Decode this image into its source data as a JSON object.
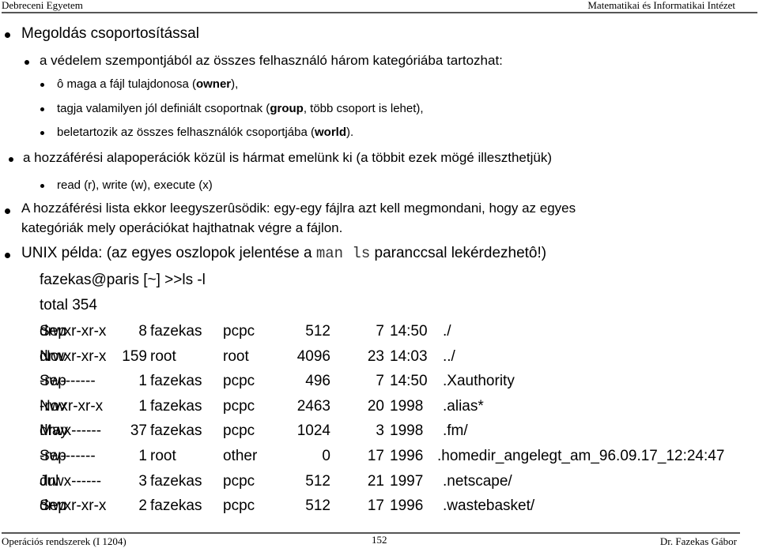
{
  "header": {
    "left": "Debreceni Egyetem",
    "right": "Matematikai és Informatikai Intézet"
  },
  "footer": {
    "left": "Operációs rendszerek (I 1204)",
    "page": "152",
    "right": "Dr. Fazekas Gábor"
  },
  "content": {
    "b1_title": "Megoldás csoportosítással",
    "b2_categories": "a védelem szempontjából az összes felhasználó három kategóriába tartozhat:",
    "b3_owner_pre": "ô maga a fájl tulajdonosa (",
    "b3_owner_bold": "owner",
    "b3_owner_post": "),",
    "b3_group_pre": "tagja valamilyen jól definiált csoportnak (",
    "b3_group_bold": "group",
    "b3_group_post": ", több csoport is lehet),",
    "b3_world_pre": "beletartozik az összes felhasználók csoportjába (",
    "b3_world_bold": "world",
    "b3_world_post": ").",
    "b2_ops": "a hozzáférési alapoperációk közül is hármat emelünk ki (a többit ezek mögé illeszthetjük)",
    "b3_rwx": "read (r), write (w), execute (x)",
    "b1_list_line1": "A hozzáférési lista ekkor leegyszerûsödik: egy-egy fájlra  azt kell megmondani, hogy az egyes",
    "b1_list_line2": "kategóriák mely operációkat hajthatnak végre a fájlon.",
    "b1_unix_pre": "UNIX példa: (az egyes oszlopok jelentése a ",
    "b1_unix_code": "man ls",
    "b1_unix_post": " paranccsal lekérdezhetô!)",
    "prompt": "fazekas@paris [~] >>ls -l",
    "total": "total 354"
  },
  "ls_rows": [
    {
      "perm": "drwxr-xr-x",
      "links": "8",
      "owner": "fazekas",
      "group": "pcpc",
      "size": "512",
      "month": "Sep",
      "day": "7",
      "time": "14:50",
      "name": "./"
    },
    {
      "perm": "drwxr-xr-x",
      "links": "159",
      "owner": "root",
      "group": "root",
      "size": "4096",
      "month": "Nov",
      "day": "23",
      "time": "14:03",
      "name": "../"
    },
    {
      "perm": "-rw-------",
      "links": "1",
      "owner": "fazekas",
      "group": "pcpc",
      "size": "496",
      "month": "Sep",
      "day": "7",
      "time": "14:50",
      "name": ".Xauthority"
    },
    {
      "perm": "-rwxr-xr-x",
      "links": "1",
      "owner": "fazekas",
      "group": "pcpc",
      "size": "2463",
      "month": "Nov",
      "day": "20",
      "time": "1998",
      "name": ".alias*"
    },
    {
      "perm": "drwx------",
      "links": "37",
      "owner": "fazekas",
      "group": "pcpc",
      "size": "1024",
      "month": "May",
      "day": "3",
      "time": "1998",
      "name": ".fm/"
    },
    {
      "perm": "-rw-------",
      "links": "1",
      "owner": "root",
      "group": "other",
      "size": "0",
      "month": "Sep",
      "day": "17",
      "time": "1996",
      "name": ".homedir_angelegt_am_96.09.17_12:24:47"
    },
    {
      "perm": "drwx------",
      "links": "3",
      "owner": "fazekas",
      "group": "pcpc",
      "size": "512",
      "month": "Jul",
      "day": "21",
      "time": "1997",
      "name": ".netscape/"
    },
    {
      "perm": "drwxr-xr-x",
      "links": "2",
      "owner": "fazekas",
      "group": "pcpc",
      "size": "512",
      "month": "Sep",
      "day": "17",
      "time": "1996",
      "name": ".wastebasket/"
    }
  ]
}
